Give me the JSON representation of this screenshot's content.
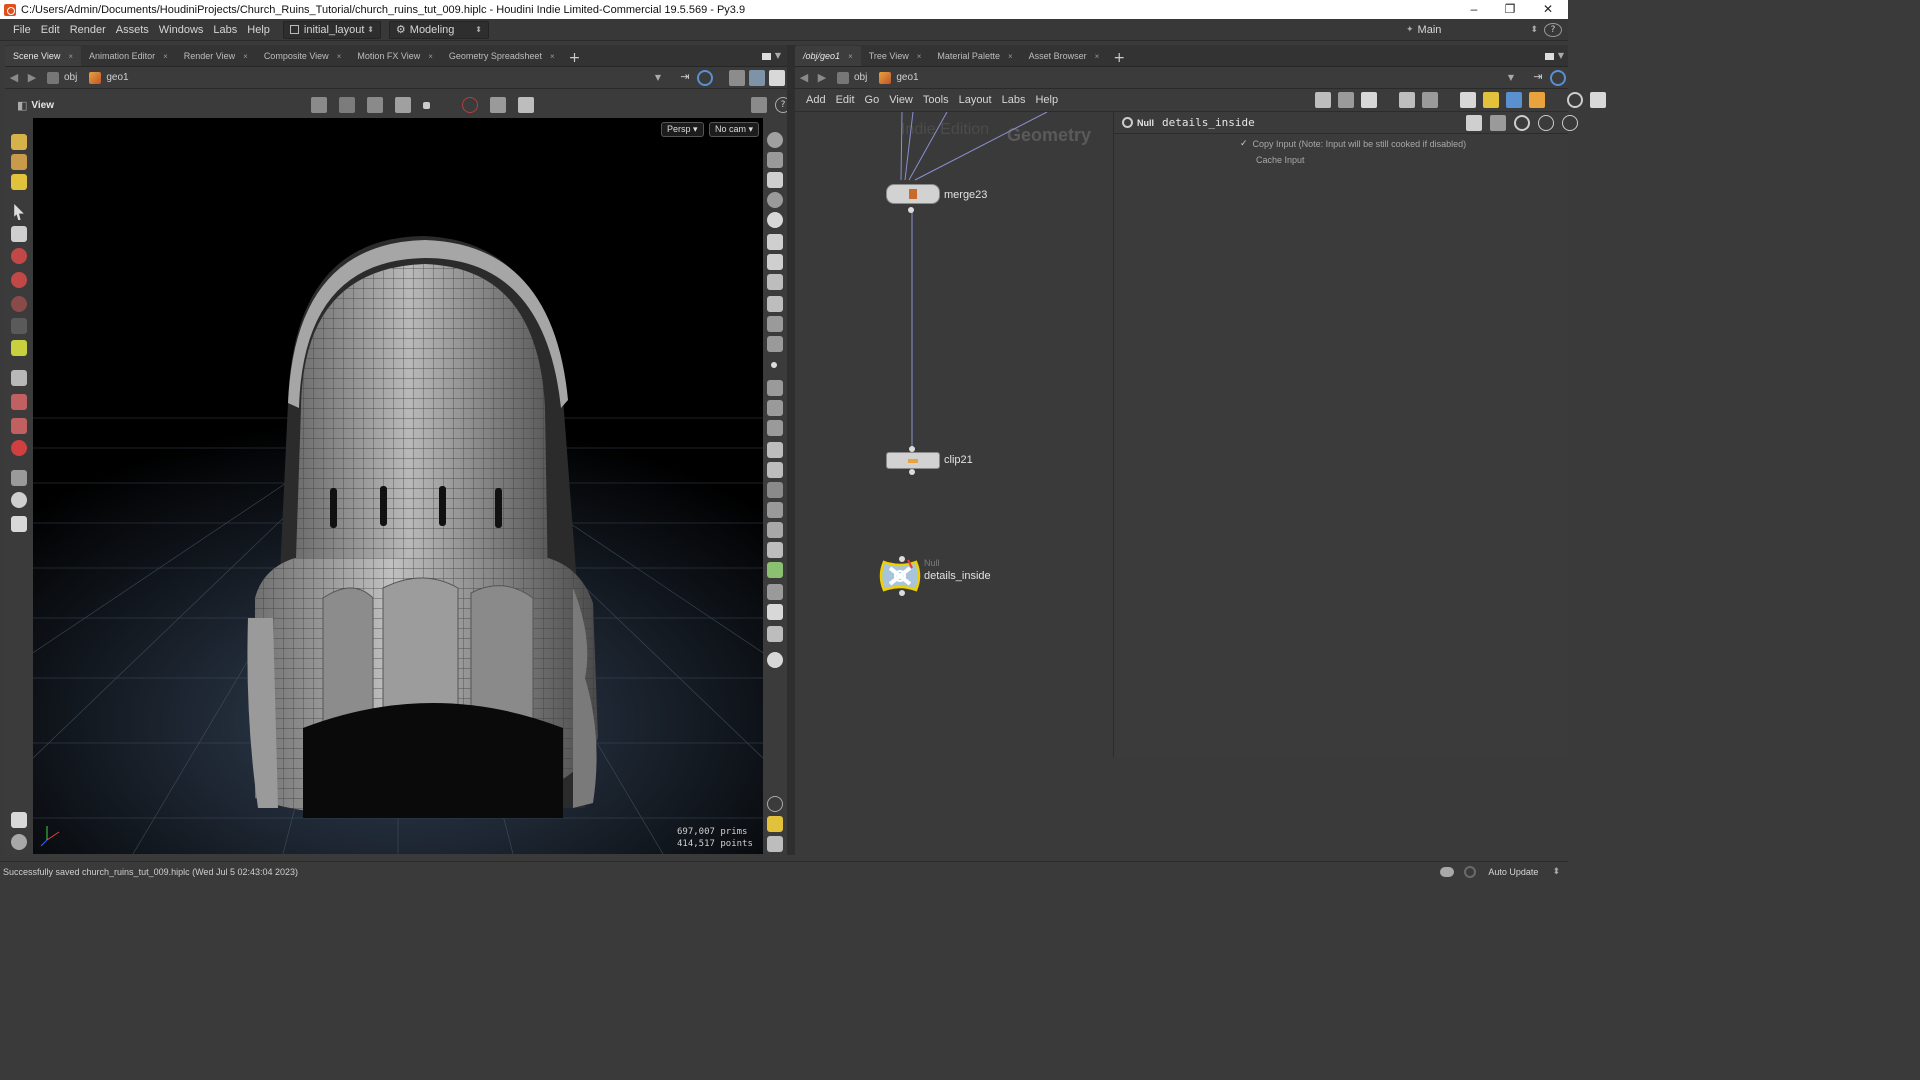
{
  "window": {
    "title": "C:/Users/Admin/Documents/HoudiniProjects/Church_Ruins_Tutorial/church_ruins_tut_009.hiplc - Houdini Indie Limited-Commercial 19.5.569 - Py3.9",
    "minimize": "–",
    "restore": "❐",
    "close": "✕"
  },
  "menubar": {
    "items": [
      "File",
      "Edit",
      "Render",
      "Assets",
      "Windows",
      "Labs",
      "Help"
    ],
    "layout_dropdown": "initial_layout",
    "desktop_dropdown": "Modeling",
    "main_dropdown": "Main",
    "help_icon": "?"
  },
  "left_pane": {
    "tabs": [
      "Scene View",
      "Animation Editor",
      "Render View",
      "Composite View",
      "Motion FX View",
      "Geometry Spreadsheet"
    ],
    "path": [
      "obj",
      "geo1"
    ],
    "view_label": "View",
    "persp_button": "Persp ▾",
    "cam_button": "No cam ▾",
    "stats": {
      "prims_value": "697,007",
      "prims_label": "prims",
      "points_value": "414,517",
      "points_label": "points"
    }
  },
  "right_pane": {
    "tabs": [
      "/obj/geo1",
      "Tree View",
      "Material Palette",
      "Asset Browser"
    ],
    "path": [
      "obj",
      "geo1"
    ],
    "menu": [
      "Add",
      "Edit",
      "Go",
      "View",
      "Tools",
      "Layout",
      "Labs",
      "Help"
    ],
    "watermark_indie": "Indie Edition",
    "watermark_context": "Geometry",
    "nodes": {
      "merge": "merge23",
      "clip": "clip21",
      "null_type": "Null",
      "null_name": "details_inside"
    },
    "parms": {
      "node_type": "Null",
      "node_name": "details_inside",
      "copy_input": "Copy Input (Note: Input will be still cooked if disabled)",
      "cache_input": "Cache Input"
    }
  },
  "statusbar": {
    "message": "Successfully saved church_ruins_tut_009.hiplc (Wed Jul  5 02:43:04 2023)",
    "update_mode": "Auto Update"
  },
  "colors": {
    "accent_orange": "#e8a33c",
    "node_wire": "#8a8fd0",
    "null_node_outline": "#f0d000",
    "null_node_fill": "#a8c4d8"
  }
}
